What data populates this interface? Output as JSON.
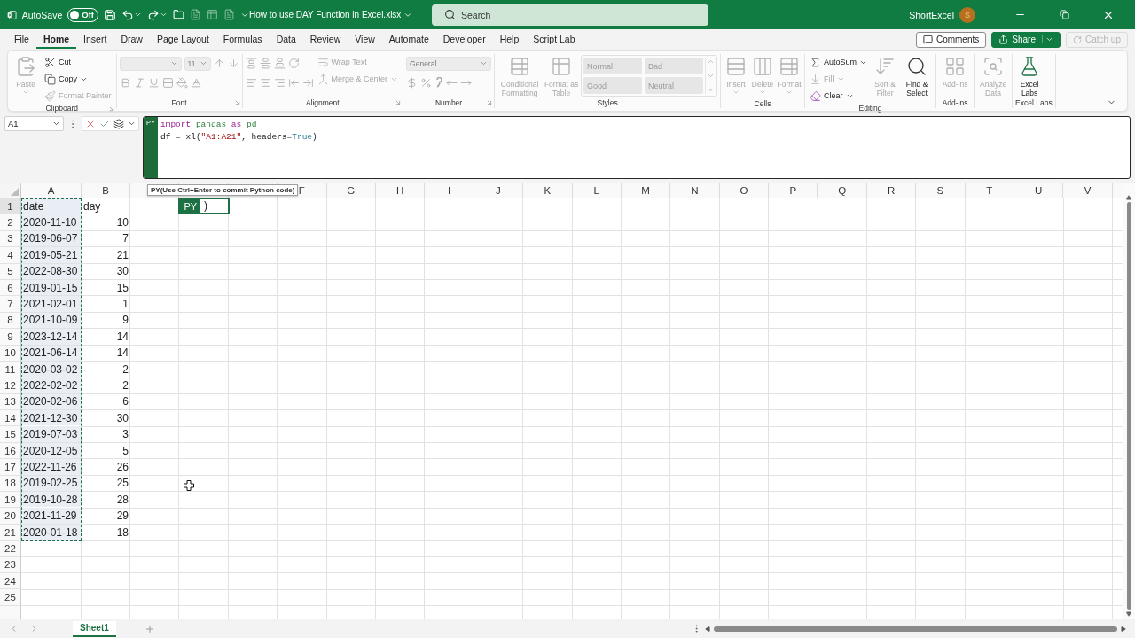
{
  "title_bar": {
    "autosave": {
      "label": "AutoSave",
      "state": "Off",
      "on": false
    },
    "file_name": "How to use DAY Function in Excel.xlsx",
    "search": {
      "placeholder": "Search"
    },
    "user": {
      "name": "ShortExcel",
      "initial": "S"
    }
  },
  "menu": {
    "tabs": [
      {
        "label": "File",
        "selected": false
      },
      {
        "label": "Home",
        "selected": true
      },
      {
        "label": "Insert",
        "selected": false
      },
      {
        "label": "Draw",
        "selected": false
      },
      {
        "label": "Page Layout",
        "selected": false
      },
      {
        "label": "Formulas",
        "selected": false
      },
      {
        "label": "Data",
        "selected": false
      },
      {
        "label": "Review",
        "selected": false
      },
      {
        "label": "View",
        "selected": false
      },
      {
        "label": "Automate",
        "selected": false
      },
      {
        "label": "Developer",
        "selected": false
      },
      {
        "label": "Help",
        "selected": false
      },
      {
        "label": "Script Lab",
        "selected": false
      }
    ],
    "actions": [
      {
        "label": "Comments",
        "kind": "outline",
        "disabled": false
      },
      {
        "label": "Share",
        "kind": "primary",
        "disabled": false
      },
      {
        "label": "Catch up",
        "kind": "ghost",
        "disabled": true
      }
    ]
  },
  "ribbon": {
    "groups": [
      {
        "kind": "clipboard",
        "label": "Clipboard",
        "launcher": true,
        "items": [
          {
            "label": "Paste",
            "disabled": true
          },
          {
            "label": "Cut",
            "disabled": false
          },
          {
            "label": "Copy",
            "disabled": false
          },
          {
            "label": "Format Painter",
            "disabled": true
          }
        ]
      },
      {
        "kind": "font",
        "label": "Font",
        "launcher": true,
        "font_size": "11"
      },
      {
        "kind": "alignment",
        "label": "Alignment",
        "launcher": true,
        "items": [
          {
            "label": "Wrap Text",
            "disabled": true
          },
          {
            "label": "Merge & Center",
            "disabled": true
          }
        ]
      },
      {
        "kind": "number",
        "label": "Number",
        "launcher": true,
        "format": "General"
      },
      {
        "kind": "styles",
        "label": "Styles",
        "items": [
          {
            "label": "Conditional Formatting",
            "disabled": true
          },
          {
            "label": "Format as Table",
            "disabled": true
          }
        ],
        "cell_styles": [
          {
            "label": "Normal"
          },
          {
            "label": "Bad"
          },
          {
            "label": "Good"
          },
          {
            "label": "Neutral"
          }
        ]
      },
      {
        "kind": "cells",
        "label": "Cells",
        "items": [
          {
            "label": "Insert",
            "disabled": true
          },
          {
            "label": "Delete",
            "disabled": true
          },
          {
            "label": "Format",
            "disabled": true
          }
        ]
      },
      {
        "kind": "editing",
        "label": "Editing",
        "items": [
          {
            "label": "AutoSum",
            "disabled": false
          },
          {
            "label": "Fill",
            "disabled": true
          },
          {
            "label": "Clear",
            "disabled": false
          },
          {
            "label": "Sort & Filter",
            "disabled": true
          },
          {
            "label": "Find & Select",
            "disabled": false
          }
        ]
      },
      {
        "kind": "addins",
        "label": "Add-ins",
        "items": [
          {
            "label": "Add-ins",
            "disabled": true
          }
        ]
      },
      {
        "kind": "analysis",
        "items": [
          {
            "label": "Analyze Data",
            "disabled": true
          }
        ]
      },
      {
        "kind": "labs",
        "label": "Excel Labs",
        "items": [
          {
            "label": "Excel Labs",
            "disabled": false
          }
        ]
      }
    ]
  },
  "formula_bar": {
    "name_box": "A1",
    "badge": "PY",
    "code": [
      [
        {
          "kind": "keyword",
          "text": "import"
        },
        {
          "kind": "name",
          "text": " pandas "
        },
        {
          "kind": "keyword",
          "text": "as"
        },
        {
          "kind": "name",
          "text": " pd"
        }
      ],
      [
        {
          "kind": "plain",
          "text": "df = xl("
        },
        {
          "kind": "string",
          "text": "\"A1:A21\""
        },
        {
          "kind": "plain",
          "text": ", headers="
        },
        {
          "kind": "constant",
          "text": "True"
        },
        {
          "kind": "plain",
          "text": ")"
        }
      ]
    ]
  },
  "tooltip": "PY(Use Ctrl+Enter to commit Python code)",
  "grid": {
    "marquee": true,
    "columns": [
      {
        "label": "A"
      },
      {
        "label": "B"
      },
      {
        "covered": true
      },
      {
        "covered": true
      },
      {
        "covered": true
      },
      {
        "label": "F"
      },
      {
        "label": "G"
      },
      {
        "label": "H"
      },
      {
        "label": "I"
      },
      {
        "label": "J"
      },
      {
        "label": "K"
      },
      {
        "label": "L"
      },
      {
        "label": "M"
      },
      {
        "label": "N"
      },
      {
        "label": "O"
      },
      {
        "label": "P"
      },
      {
        "label": "Q"
      },
      {
        "label": "R"
      },
      {
        "label": "S"
      },
      {
        "label": "T"
      },
      {
        "label": "U"
      },
      {
        "label": "V"
      }
    ],
    "editing_cell": {
      "badge": "PY",
      "value": ")"
    },
    "rows": [
      {
        "number": "1",
        "cells": [
          {
            "value": "date",
            "kind": "text"
          },
          {
            "value": "day",
            "kind": "text"
          }
        ]
      },
      {
        "number": "2",
        "cells": [
          {
            "value": "2020-11-10",
            "kind": "text"
          },
          {
            "value": "10",
            "kind": "number"
          }
        ]
      },
      {
        "number": "3",
        "cells": [
          {
            "value": "2019-06-07",
            "kind": "text"
          },
          {
            "value": "7",
            "kind": "number"
          }
        ]
      },
      {
        "number": "4",
        "cells": [
          {
            "value": "2019-05-21",
            "kind": "text"
          },
          {
            "value": "21",
            "kind": "number"
          }
        ]
      },
      {
        "number": "5",
        "cells": [
          {
            "value": "2022-08-30",
            "kind": "text"
          },
          {
            "value": "30",
            "kind": "number"
          }
        ]
      },
      {
        "number": "6",
        "cells": [
          {
            "value": "2019-01-15",
            "kind": "text"
          },
          {
            "value": "15",
            "kind": "number"
          }
        ]
      },
      {
        "number": "7",
        "cells": [
          {
            "value": "2021-02-01",
            "kind": "text"
          },
          {
            "value": "1",
            "kind": "number"
          }
        ]
      },
      {
        "number": "8",
        "cells": [
          {
            "value": "2021-10-09",
            "kind": "text"
          },
          {
            "value": "9",
            "kind": "number"
          }
        ]
      },
      {
        "number": "9",
        "cells": [
          {
            "value": "2023-12-14",
            "kind": "text"
          },
          {
            "value": "14",
            "kind": "number"
          }
        ]
      },
      {
        "number": "10",
        "cells": [
          {
            "value": "2021-06-14",
            "kind": "text"
          },
          {
            "value": "14",
            "kind": "number"
          }
        ]
      },
      {
        "number": "11",
        "cells": [
          {
            "value": "2020-03-02",
            "kind": "text"
          },
          {
            "value": "2",
            "kind": "number"
          }
        ]
      },
      {
        "number": "12",
        "cells": [
          {
            "value": "2022-02-02",
            "kind": "text"
          },
          {
            "value": "2",
            "kind": "number"
          }
        ]
      },
      {
        "number": "13",
        "cells": [
          {
            "value": "2020-02-06",
            "kind": "text"
          },
          {
            "value": "6",
            "kind": "number"
          }
        ]
      },
      {
        "number": "14",
        "cells": [
          {
            "value": "2021-12-30",
            "kind": "text"
          },
          {
            "value": "30",
            "kind": "number"
          }
        ]
      },
      {
        "number": "15",
        "cells": [
          {
            "value": "2019-07-03",
            "kind": "text"
          },
          {
            "value": "3",
            "kind": "number"
          }
        ]
      },
      {
        "number": "16",
        "cells": [
          {
            "value": "2020-12-05",
            "kind": "text"
          },
          {
            "value": "5",
            "kind": "number"
          }
        ]
      },
      {
        "number": "17",
        "cells": [
          {
            "value": "2022-11-26",
            "kind": "text"
          },
          {
            "value": "26",
            "kind": "number"
          }
        ]
      },
      {
        "number": "18",
        "cells": [
          {
            "value": "2019-02-25",
            "kind": "text"
          },
          {
            "value": "25",
            "kind": "number"
          }
        ]
      },
      {
        "number": "19",
        "cells": [
          {
            "value": "2019-10-28",
            "kind": "text"
          },
          {
            "value": "28",
            "kind": "number"
          }
        ]
      },
      {
        "number": "20",
        "cells": [
          {
            "value": "2021-11-29",
            "kind": "text"
          },
          {
            "value": "29",
            "kind": "number"
          }
        ]
      },
      {
        "number": "21",
        "cells": [
          {
            "value": "2020-01-18",
            "kind": "text"
          },
          {
            "value": "18",
            "kind": "number"
          }
        ]
      },
      {
        "number": "22"
      },
      {
        "number": "23"
      },
      {
        "number": "24"
      },
      {
        "number": "25"
      }
    ]
  },
  "sheets": [
    {
      "label": "Sheet1",
      "selected": true
    }
  ]
}
